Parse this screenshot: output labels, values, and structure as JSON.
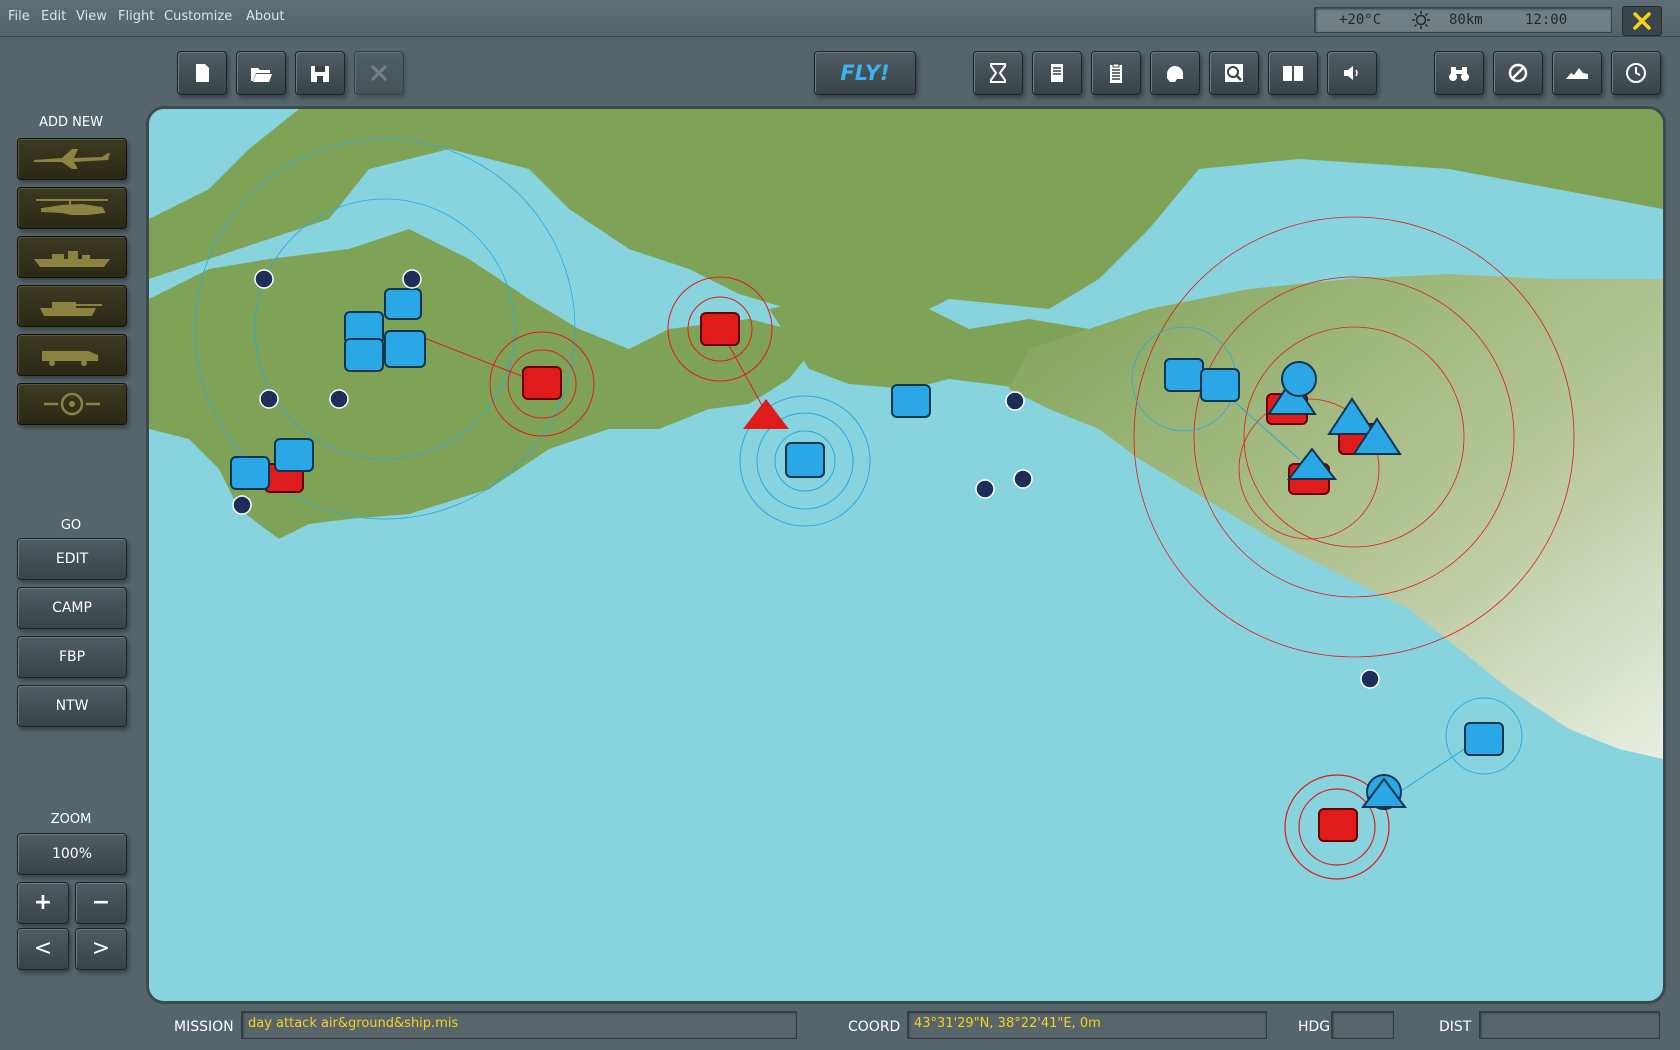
{
  "menu": [
    "File",
    "Edit",
    "View",
    "Flight",
    "Customize",
    "About"
  ],
  "weather": {
    "temperature": "+20°C",
    "visibility": "80km",
    "time": "12:00",
    "icon": "sun-icon"
  },
  "toolbar": {
    "fly_label": "FLY!"
  },
  "sidebar": {
    "add_new_label": "ADD NEW",
    "unit_buttons": [
      "plane-icon",
      "helicopter-icon",
      "ship-icon",
      "tank-icon",
      "vehicle-icon",
      "target-icon"
    ],
    "go_label": "GO",
    "go_buttons": [
      "EDIT",
      "CAMP",
      "FBP",
      "NTW"
    ],
    "zoom_label": "ZOOM",
    "zoom_value": "100%",
    "zoom_in": "+",
    "zoom_out": "−",
    "prev": "<",
    "next": ">"
  },
  "status": {
    "mission_label": "MISSION",
    "mission_value": "day attack air&ground&ship.mis",
    "coord_label": "COORD",
    "coord_value": "43°31'29\"N, 38°22'41\"E, 0m",
    "hdg_label": "HDG",
    "hdg_value": "",
    "dist_label": "DIST",
    "dist_value": ""
  },
  "colors": {
    "blue_unit": "#2aa7e4",
    "red_unit": "#e01b1b",
    "sea": "#87d4de",
    "land": "#7fa356",
    "accent": "#f4d21e"
  }
}
